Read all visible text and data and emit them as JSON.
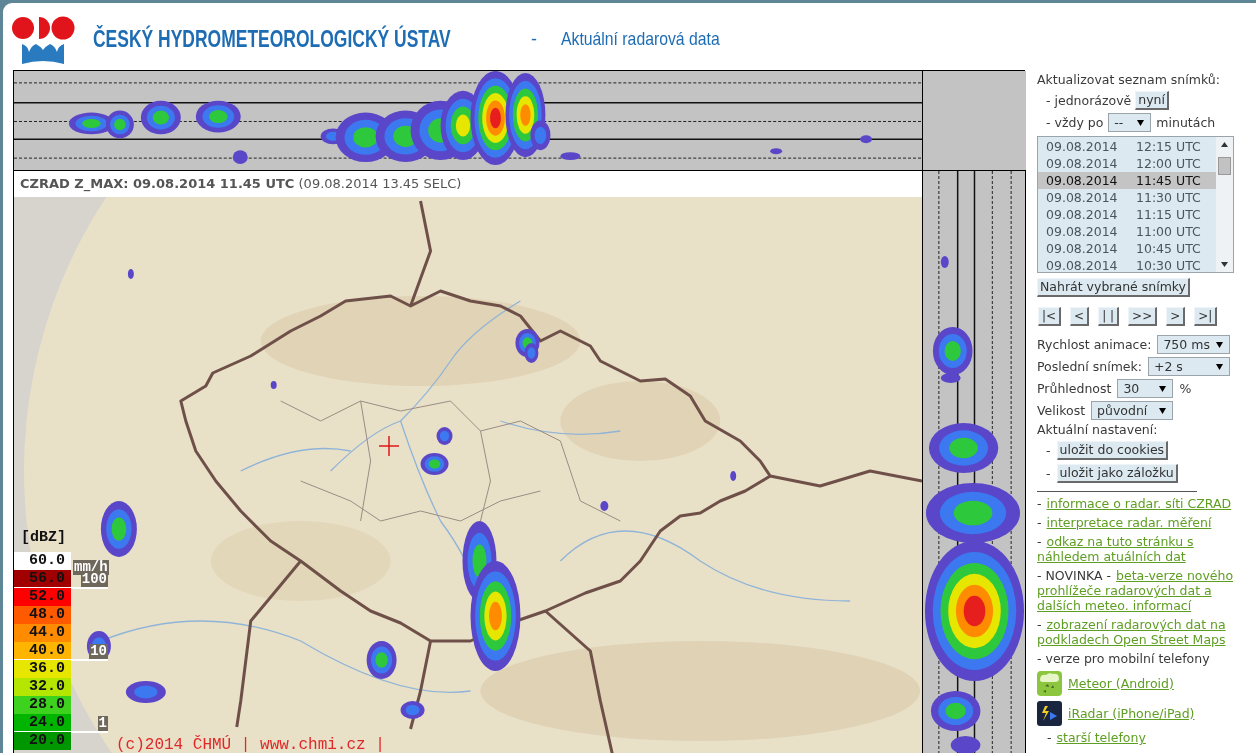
{
  "header": {
    "title": "ČESKÝ HYDROMETEOROLOGICKÝ ÚSTAV",
    "separator": "-",
    "subtitle": "Aktuální radarová data"
  },
  "radar": {
    "caption": "**CZRAD Z_MAX: 09.08.2014 11.45 UTC** (09.08.2014 13.45 SELC)",
    "legend": {
      "unit": "[dBZ]",
      "rain_unit": "mm/h",
      "items": [
        {
          "label": "60.0",
          "color": "#ffffff"
        },
        {
          "label": "56.0",
          "color": "#a00000",
          "rain_mark": "100"
        },
        {
          "label": "52.0",
          "color": "#ff0000"
        },
        {
          "label": "48.0",
          "color": "#ff5a00"
        },
        {
          "label": "44.0",
          "color": "#ff8c00"
        },
        {
          "label": "40.0",
          "color": "#ffb400",
          "rain_mark": "10"
        },
        {
          "label": "36.0",
          "color": "#e6e600"
        },
        {
          "label": "32.0",
          "color": "#b4e600"
        },
        {
          "label": "28.0",
          "color": "#3cd21e"
        },
        {
          "label": "24.0",
          "color": "#00b400",
          "rain_mark": "1"
        },
        {
          "label": "20.0",
          "color": "#009600"
        }
      ]
    },
    "copyright": "(c)2014 ČHMÚ | www.chmi.cz |"
  },
  "panel": {
    "refresh": {
      "title": "Aktualizovat seznam snímků:",
      "once": {
        "prefix": "- jednorázově",
        "button": "nyní"
      },
      "every": {
        "prefix": "- vždy po",
        "value": "--",
        "unit": "minutách"
      }
    },
    "frames": [
      {
        "date": "09.08.2014",
        "time": "12:15 UTC",
        "selected": false
      },
      {
        "date": "09.08.2014",
        "time": "12:00 UTC",
        "selected": false
      },
      {
        "date": "09.08.2014",
        "time": "11:45 UTC",
        "selected": true
      },
      {
        "date": "09.08.2014",
        "time": "11:30 UTC",
        "selected": false
      },
      {
        "date": "09.08.2014",
        "time": "11:15 UTC",
        "selected": false
      },
      {
        "date": "09.08.2014",
        "time": "11:00 UTC",
        "selected": false
      },
      {
        "date": "09.08.2014",
        "time": "10:45 UTC",
        "selected": false
      },
      {
        "date": "09.08.2014",
        "time": "10:30 UTC",
        "selected": false
      }
    ],
    "load_button": "Nahrát vybrané snímky",
    "playback_buttons": [
      "|<",
      "<",
      "| |",
      ">>",
      ">",
      ">|"
    ],
    "settings": [
      {
        "label": "Rychlost animace:",
        "value": "750 ms"
      },
      {
        "label": "Poslední snímek:",
        "value": "+2 s"
      },
      {
        "label": "Průhlednost",
        "value": "30",
        "suffix": "%"
      },
      {
        "label": "Velikost",
        "value": "původní"
      }
    ],
    "saved": {
      "title": "Aktuální nastavení:",
      "buttons": [
        {
          "prefix": "-",
          "label": "uložit do cookies"
        },
        {
          "prefix": "-",
          "label": "uložit jako záložku"
        }
      ]
    },
    "links": [
      {
        "kind": "link",
        "prefix": "-",
        "text": "informace o radar. síti CZRAD"
      },
      {
        "kind": "link",
        "prefix": "-",
        "text": "interpretace radar. měření"
      },
      {
        "kind": "link",
        "prefix": "-",
        "text": "odkaz na tuto stránku s náhledem atuálních dat"
      },
      {
        "kind": "link",
        "prefix": "- NOVINKA -",
        "text": "beta-verze nového prohlížeče radarových dat a dalších meteo. informací"
      },
      {
        "kind": "link",
        "prefix": "-",
        "text": "zobrazení radarových dat na podkladech Open Street Maps"
      },
      {
        "kind": "text",
        "text": "- verze pro mobilní telefony"
      },
      {
        "kind": "app",
        "text": "Meteor (Android)"
      },
      {
        "kind": "app",
        "text": "iRadar (iPhone/iPad)"
      },
      {
        "kind": "sublink",
        "prefix": "-",
        "text": "starší telefony"
      }
    ]
  }
}
